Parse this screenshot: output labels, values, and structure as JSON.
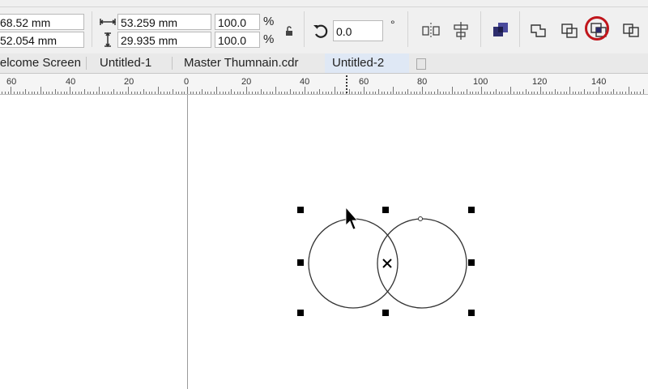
{
  "toolbar": {
    "pos_x": "68.52 mm",
    "pos_y": "52.054 mm",
    "width": "53.259 mm",
    "height": "29.935 mm",
    "scale_x": "100.0",
    "scale_y": "100.0",
    "percent_sym": "%",
    "rotation": "0.0",
    "degree_sym": "°"
  },
  "tabs": [
    {
      "label": "Welcome Screen"
    },
    {
      "label": "Untitled-1"
    },
    {
      "label": "Master Thumnain.cdr"
    },
    {
      "label": "Untitled-2"
    }
  ],
  "ruler": {
    "labels": [
      "60",
      "40",
      "20",
      "0",
      "20",
      "40",
      "60",
      "80",
      "100",
      "120",
      "140"
    ]
  },
  "colors": {
    "highlight_ring": "#c0161c",
    "active_tab": "#dfe8f5",
    "selection_handle": "#000000"
  }
}
